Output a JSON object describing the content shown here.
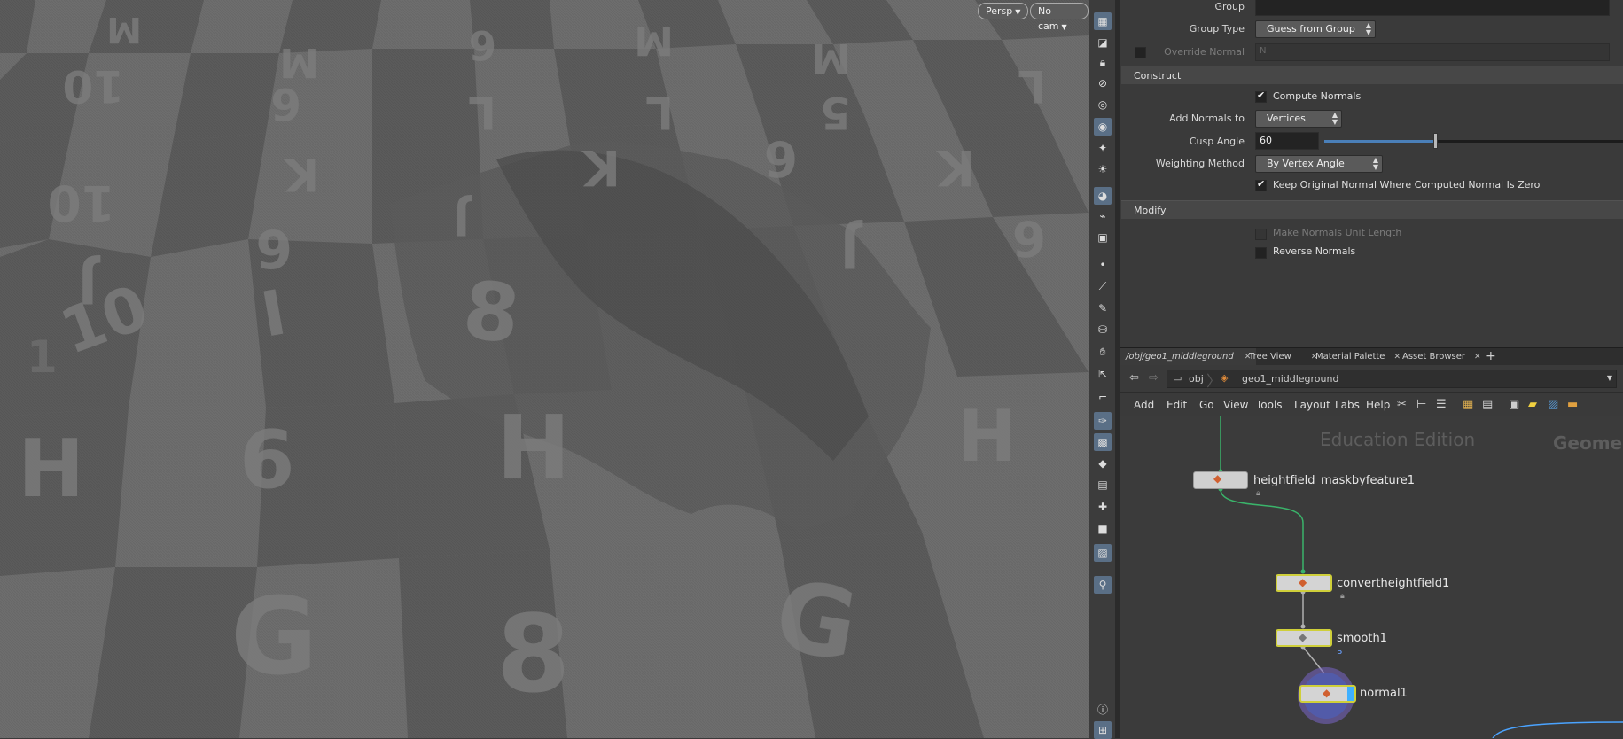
{
  "viewport": {
    "persp_label": "Persp",
    "cam_label": "No cam"
  },
  "toolbar": {
    "icons": [
      "display-options-icon",
      "ghost-icon",
      "lock-icon",
      "safe-area-icon",
      "snapshot-icon",
      "render-icon",
      "light-icon",
      "light-link-icon",
      "headlight-icon",
      "camera-icon",
      "camera-icon",
      "scene-icon",
      "point-icon",
      "brush-icon",
      "pen-icon",
      "stamp-icon",
      "hand-icon",
      "cursor-icon",
      "grid-icon",
      "shelf-icon",
      "info-icon",
      "layout-icon"
    ]
  },
  "params": {
    "group_label": "Group",
    "group_type_label": "Group Type",
    "group_type_value": "Guess from Group",
    "override_normal_label": "Override Normal",
    "override_normal_field": "N",
    "construct_section": "Construct",
    "compute_normals_label": "Compute Normals",
    "add_normals_label": "Add Normals to",
    "add_normals_value": "Vertices",
    "cusp_angle_label": "Cusp Angle",
    "cusp_angle_value": "60",
    "weighting_label": "Weighting Method",
    "weighting_value": "By Vertex Angle",
    "keep_original_label": "Keep Original Normal Where Computed Normal Is Zero",
    "modify_section": "Modify",
    "unit_length_label": "Make Normals Unit Length",
    "reverse_label": "Reverse Normals"
  },
  "network": {
    "tabs": [
      "/obj/geo1_middleground",
      "Tree View",
      "Material Palette",
      "Asset Browser"
    ],
    "path_obj": "obj",
    "path_geo": "geo1_middleground",
    "menu": [
      "Add",
      "Edit",
      "Go",
      "View",
      "Tools",
      "Layout",
      "Labs",
      "Help"
    ],
    "watermark": "Education Edition",
    "watermark2": "Geome",
    "nodes": {
      "n1": "heightfield_maskbyfeature1",
      "n2": "convertheightfield1",
      "n3": "smooth1",
      "n4": "normal1",
      "flag_p": "P"
    }
  },
  "colors": {
    "accent": "#cfcf3a",
    "selection": "#4aa3ff",
    "wire": "#3ab36a"
  }
}
